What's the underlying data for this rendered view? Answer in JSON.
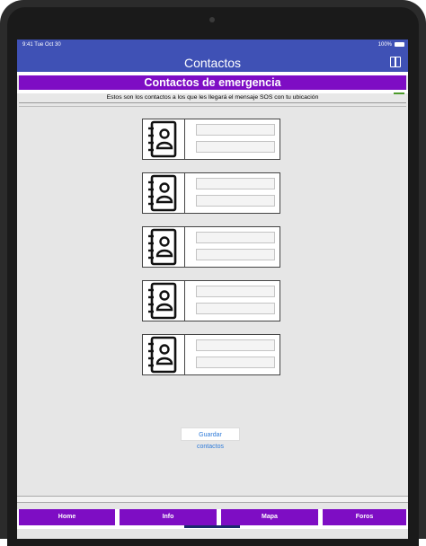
{
  "status_bar": {
    "time": "9:41 Tue Oct 30",
    "battery": "100%"
  },
  "navbar": {
    "title": "Contactos",
    "split_view_icon": "split-view-icon"
  },
  "header": {
    "title": "Contactos de emergencia"
  },
  "subtitle": {
    "text": "Estos son los contactos a los que les llegará el mensaje SOS con tu ubicación"
  },
  "contacts": [
    {
      "icon": "address-book-icon",
      "name_value": "",
      "phone_value": ""
    },
    {
      "icon": "address-book-icon",
      "name_value": "",
      "phone_value": ""
    },
    {
      "icon": "address-book-icon",
      "name_value": "",
      "phone_value": ""
    },
    {
      "icon": "address-book-icon",
      "name_value": "",
      "phone_value": ""
    },
    {
      "icon": "address-book-icon",
      "name_value": "",
      "phone_value": ""
    }
  ],
  "save_button": {
    "label": "Guardar contactos"
  },
  "tabs": [
    {
      "label": "Home"
    },
    {
      "label": "Info",
      "selected": true
    },
    {
      "label": "Mapa"
    },
    {
      "label": "Foros"
    }
  ],
  "colors": {
    "navbar": "#3f51b5",
    "accent": "#7e0dc4",
    "link": "#2f7bd9"
  }
}
